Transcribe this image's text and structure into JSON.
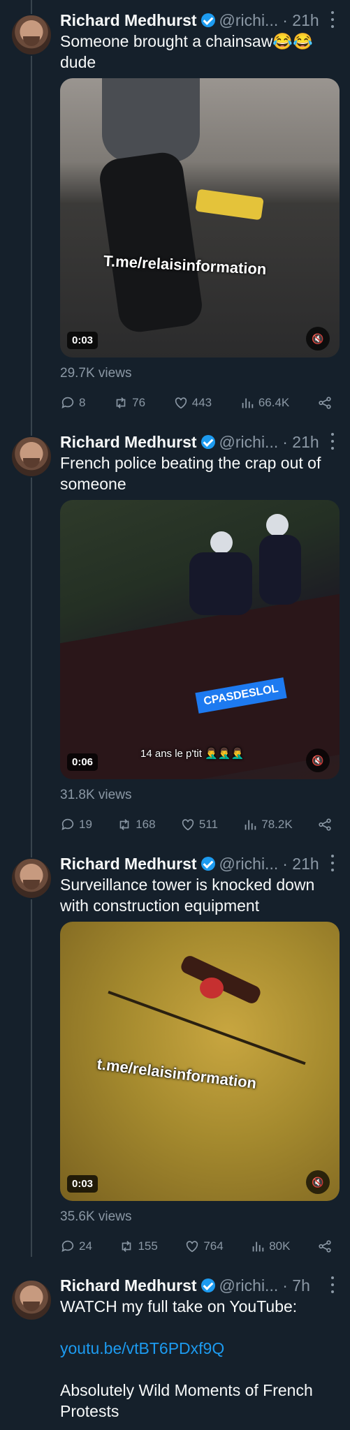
{
  "author": {
    "name": "Richard Medhurst",
    "handle": "@richi..."
  },
  "tweets": [
    {
      "time": "· 21h",
      "text": "Someone brought a chainsaw😂😂 dude",
      "media": {
        "watermark": "T.me/relaisinformation",
        "duration": "0:03"
      },
      "views": "29.7K views",
      "stats": {
        "replies": "8",
        "retweets": "76",
        "likes": "443",
        "analytics": "66.4K"
      }
    },
    {
      "time": "· 21h",
      "text": "French police beating the crap out of someone",
      "media": {
        "watermark": "CPASDESLOL",
        "caption": "14 ans le p'tit 🤦‍♂️🤦‍♂️🤦‍♂️",
        "duration": "0:06"
      },
      "views": "31.8K views",
      "stats": {
        "replies": "19",
        "retweets": "168",
        "likes": "511",
        "analytics": "78.2K"
      }
    },
    {
      "time": "· 21h",
      "text": "Surveillance tower is knocked down with construction equipment",
      "media": {
        "watermark": "t.me/relaisinformation",
        "duration": "0:03"
      },
      "views": "35.6K views",
      "stats": {
        "replies": "24",
        "retweets": "155",
        "likes": "764",
        "analytics": "80K"
      }
    },
    {
      "time": "· 7h",
      "text": "WATCH my full take on YouTube:",
      "link": "youtu.be/vtBT6PDxf9Q",
      "text2": "Absolutely Wild Moments of French Protests"
    }
  ],
  "colors": {
    "background": "#15202b",
    "accent": "#1d9bf0",
    "muted": "#8b98a5"
  }
}
